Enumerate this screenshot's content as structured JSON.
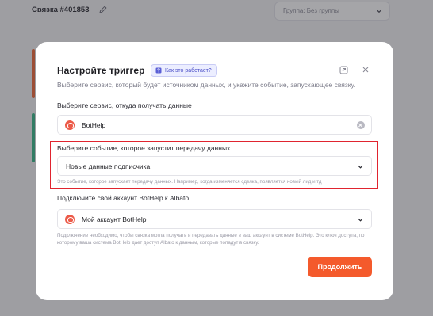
{
  "background": {
    "title": "Связка #401853",
    "group_select": "Группа: Без группы"
  },
  "modal": {
    "title": "Настройте триггер",
    "how_it_works": "Как это работает?",
    "subtitle": "Выберите сервис, который будет источником данных, и укажите событие, запускающее связку.",
    "service": {
      "label": "Выберите сервис, откуда получать данные",
      "value": "BotHelp"
    },
    "event": {
      "label": "Выберите событие, которое запустит передачу данных",
      "value": "Новые данные подписчика",
      "hint": "Это событие, которое запускает передачу данных. Например, когда изменяется сделка, появляется новый лид и тд"
    },
    "account": {
      "label": "Подключите свой аккаунт BotHelp к Albato",
      "value": "Мой аккаунт BotHelp",
      "hint": "Подключение необходимо, чтобы связка могла получать и передавать данные в ваш аккаунт в системе BotHelp. Это ключ доступа, по которому ваша система BotHelp дает доступ Albato к данным, которые попадут в связку."
    },
    "continue_button": "Продолжить"
  },
  "colors": {
    "accent": "#f45a2c",
    "highlight": "#e0242f",
    "badge_bg": "#eceeff",
    "service_logo": "#ec5a48"
  },
  "icons": [
    "edit-icon",
    "chevron-down-icon",
    "question-book-icon",
    "expand-icon",
    "close-icon",
    "bothelp-logo-icon",
    "clear-icon"
  ]
}
